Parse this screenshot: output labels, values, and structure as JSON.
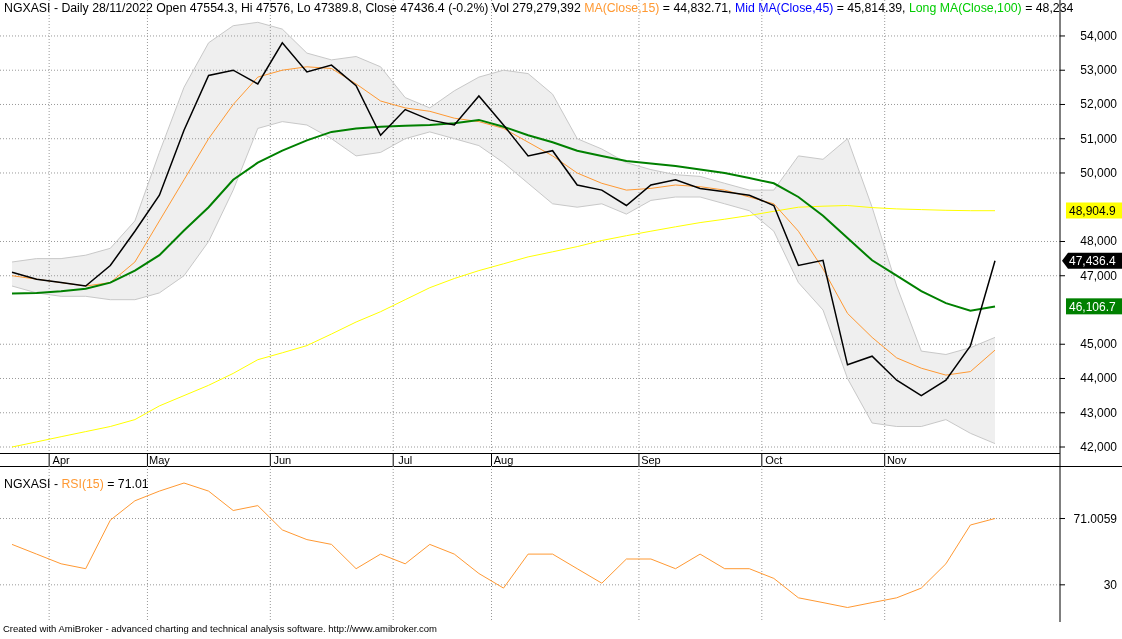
{
  "price_chart": {
    "header": {
      "info": "NGXASI - Daily 28/11/2022 Open 47554.3, Hi 47576, Lo 47389.8, Close 47436.4 (-0.2%) Vol 279,279,392",
      "legend": [
        {
          "label": "MA(Close,15)",
          "color": "#ff9933",
          "value": "= 44,832.71,"
        },
        {
          "label": "Mid MA(Close,45)",
          "color": "#0000ff",
          "value": "= 45,814.39,"
        },
        {
          "label": "Long MA(Close,100)",
          "color": "#00cc00",
          "value": "= 48,234"
        }
      ]
    },
    "end_labels": [
      {
        "text": "48,904.9",
        "kind": "flag",
        "color": "#ffff00"
      },
      {
        "text": "47,436.4",
        "kind": "arrow",
        "color": "#000000"
      },
      {
        "text": "46,106.7",
        "kind": "flag",
        "color": "#008000"
      }
    ],
    "line_styles": [
      {
        "kind": "band_upper"
      },
      {
        "kind": "band_lower"
      },
      {
        "kind": "thin"
      },
      {
        "kind": "thin"
      },
      {
        "kind": "thick"
      },
      {
        "kind": "price"
      }
    ],
    "chart_data": {
      "type": "line",
      "grid": true,
      "categories": [
        null,
        null,
        "Apr",
        null,
        null,
        null,
        "May",
        null,
        null,
        null,
        null,
        "Jun",
        null,
        null,
        null,
        null,
        "Jul",
        null,
        null,
        null,
        "Aug",
        null,
        null,
        null,
        null,
        null,
        "Sep",
        null,
        null,
        null,
        null,
        "Oct",
        null,
        null,
        null,
        null,
        "Nov",
        null,
        null,
        null,
        null
      ],
      "ylim": [
        41825,
        55050
      ],
      "yticks": [
        {
          "value": 42000,
          "label": "42,000"
        },
        {
          "value": 43000,
          "label": "43,000"
        },
        {
          "value": 44000,
          "label": "44,000"
        },
        {
          "value": 45000,
          "label": "45,000"
        },
        {
          "value": 47000,
          "label": "47,000"
        },
        {
          "value": 48000,
          "label": "48,000"
        },
        {
          "value": 50000,
          "label": "50,000"
        },
        {
          "value": 51000,
          "label": "51,000"
        },
        {
          "value": 52000,
          "label": "52,000"
        },
        {
          "value": 53000,
          "label": "53,000"
        },
        {
          "value": 54000,
          "label": "54,000"
        }
      ],
      "series": [
        {
          "color": "#c8c8c8",
          "values": [
            47400,
            47500,
            47500,
            47600,
            47800,
            48600,
            50600,
            52500,
            53800,
            54300,
            54400,
            54200,
            53500,
            53300,
            53400,
            53100,
            52200,
            51900,
            52400,
            52800,
            53000,
            52900,
            52300,
            51000,
            50700,
            50300,
            50100,
            49950,
            49900,
            49700,
            49500,
            49500,
            50500,
            50400,
            51000,
            49000,
            46700,
            44800,
            44700,
            44900,
            45200
          ]
        },
        {
          "color": "#c8c8c8",
          "values": [
            46700,
            46500,
            46400,
            46400,
            46300,
            46300,
            46500,
            47000,
            48000,
            49500,
            51300,
            51500,
            51400,
            51000,
            50500,
            50600,
            51000,
            51200,
            51000,
            50800,
            50300,
            49700,
            49100,
            49000,
            49100,
            48800,
            49200,
            49300,
            49300,
            49100,
            48900,
            48300,
            46800,
            46000,
            44000,
            42700,
            42600,
            42600,
            42800,
            42400,
            42100
          ]
        },
        {
          "color": "#ffff00",
          "values": [
            42000,
            42150,
            42300,
            42450,
            42600,
            42800,
            43200,
            43500,
            43800,
            44150,
            44550,
            44750,
            44960,
            45300,
            45650,
            45950,
            46300,
            46650,
            46920,
            47150,
            47350,
            47550,
            47700,
            47850,
            48030,
            48170,
            48300,
            48430,
            48550,
            48650,
            48760,
            48880,
            49000,
            49030,
            49050,
            48990,
            48950,
            48930,
            48910,
            48900,
            48900
          ]
        },
        {
          "color": "#ff9933",
          "values": [
            47000,
            46900,
            46800,
            46700,
            46800,
            47400,
            48600,
            49800,
            51000,
            52000,
            52800,
            53000,
            53100,
            53050,
            52600,
            52100,
            51900,
            51800,
            51600,
            51500,
            51300,
            50900,
            50500,
            50000,
            49700,
            49500,
            49550,
            49650,
            49600,
            49500,
            49300,
            49100,
            48300,
            47200,
            45900,
            45200,
            44600,
            44300,
            44100,
            44200,
            44830
          ]
        },
        {
          "color": "#008000",
          "values": [
            46480,
            46500,
            46550,
            46620,
            46800,
            47150,
            47600,
            48320,
            49000,
            49800,
            50300,
            50650,
            50950,
            51200,
            51300,
            51350,
            51380,
            51400,
            51450,
            51550,
            51350,
            51100,
            50900,
            50650,
            50500,
            50350,
            50280,
            50200,
            50100,
            50000,
            49850,
            49700,
            49300,
            48750,
            48100,
            47450,
            47000,
            46550,
            46200,
            45980,
            46100
          ]
        },
        {
          "color": "#000000",
          "values": [
            47100,
            46900,
            46800,
            46700,
            47300,
            48300,
            49350,
            51250,
            52850,
            53000,
            52600,
            53800,
            52950,
            53150,
            52550,
            51100,
            51850,
            51550,
            51400,
            52250,
            51400,
            50500,
            50650,
            49650,
            49500,
            49050,
            49650,
            49800,
            49550,
            49450,
            49350,
            49050,
            47300,
            47450,
            44400,
            44650,
            43950,
            43500,
            43950,
            44950,
            47440
          ]
        }
      ]
    }
  },
  "rsi_chart": {
    "header": {
      "info": "NGXASI -",
      "legend": [
        {
          "label": "RSI(15)",
          "color": "#ff9933",
          "value": "= 71.01"
        }
      ]
    },
    "chart_data": {
      "type": "line",
      "grid": true,
      "ylim": [
        7,
        103.5
      ],
      "yticks": [
        {
          "value": 30,
          "label": "30"
        },
        {
          "value": 71.0059,
          "label": "71.0059"
        }
      ],
      "categories": [
        null,
        null,
        null,
        null,
        null,
        null,
        null,
        null,
        null,
        null,
        null,
        null,
        null,
        null,
        null,
        null,
        null,
        null,
        null,
        null,
        null,
        null,
        null,
        null,
        null,
        null,
        null,
        null,
        null,
        null,
        null,
        null,
        null,
        null,
        null,
        null,
        null,
        null,
        null,
        null,
        null
      ],
      "series": [
        {
          "color": "#ff9933",
          "values": [
            55,
            49,
            43,
            40,
            70,
            82,
            88,
            93,
            88,
            76,
            79,
            64,
            58,
            55,
            40,
            49,
            43,
            55,
            49,
            37,
            28,
            49,
            49,
            40,
            31,
            46,
            46,
            40,
            49,
            40,
            40,
            34,
            22,
            19,
            16,
            19,
            22,
            28,
            43,
            67,
            71
          ]
        }
      ]
    }
  },
  "footer": "Created with AmiBroker - advanced charting and technical analysis software. http://www.amibroker.com"
}
